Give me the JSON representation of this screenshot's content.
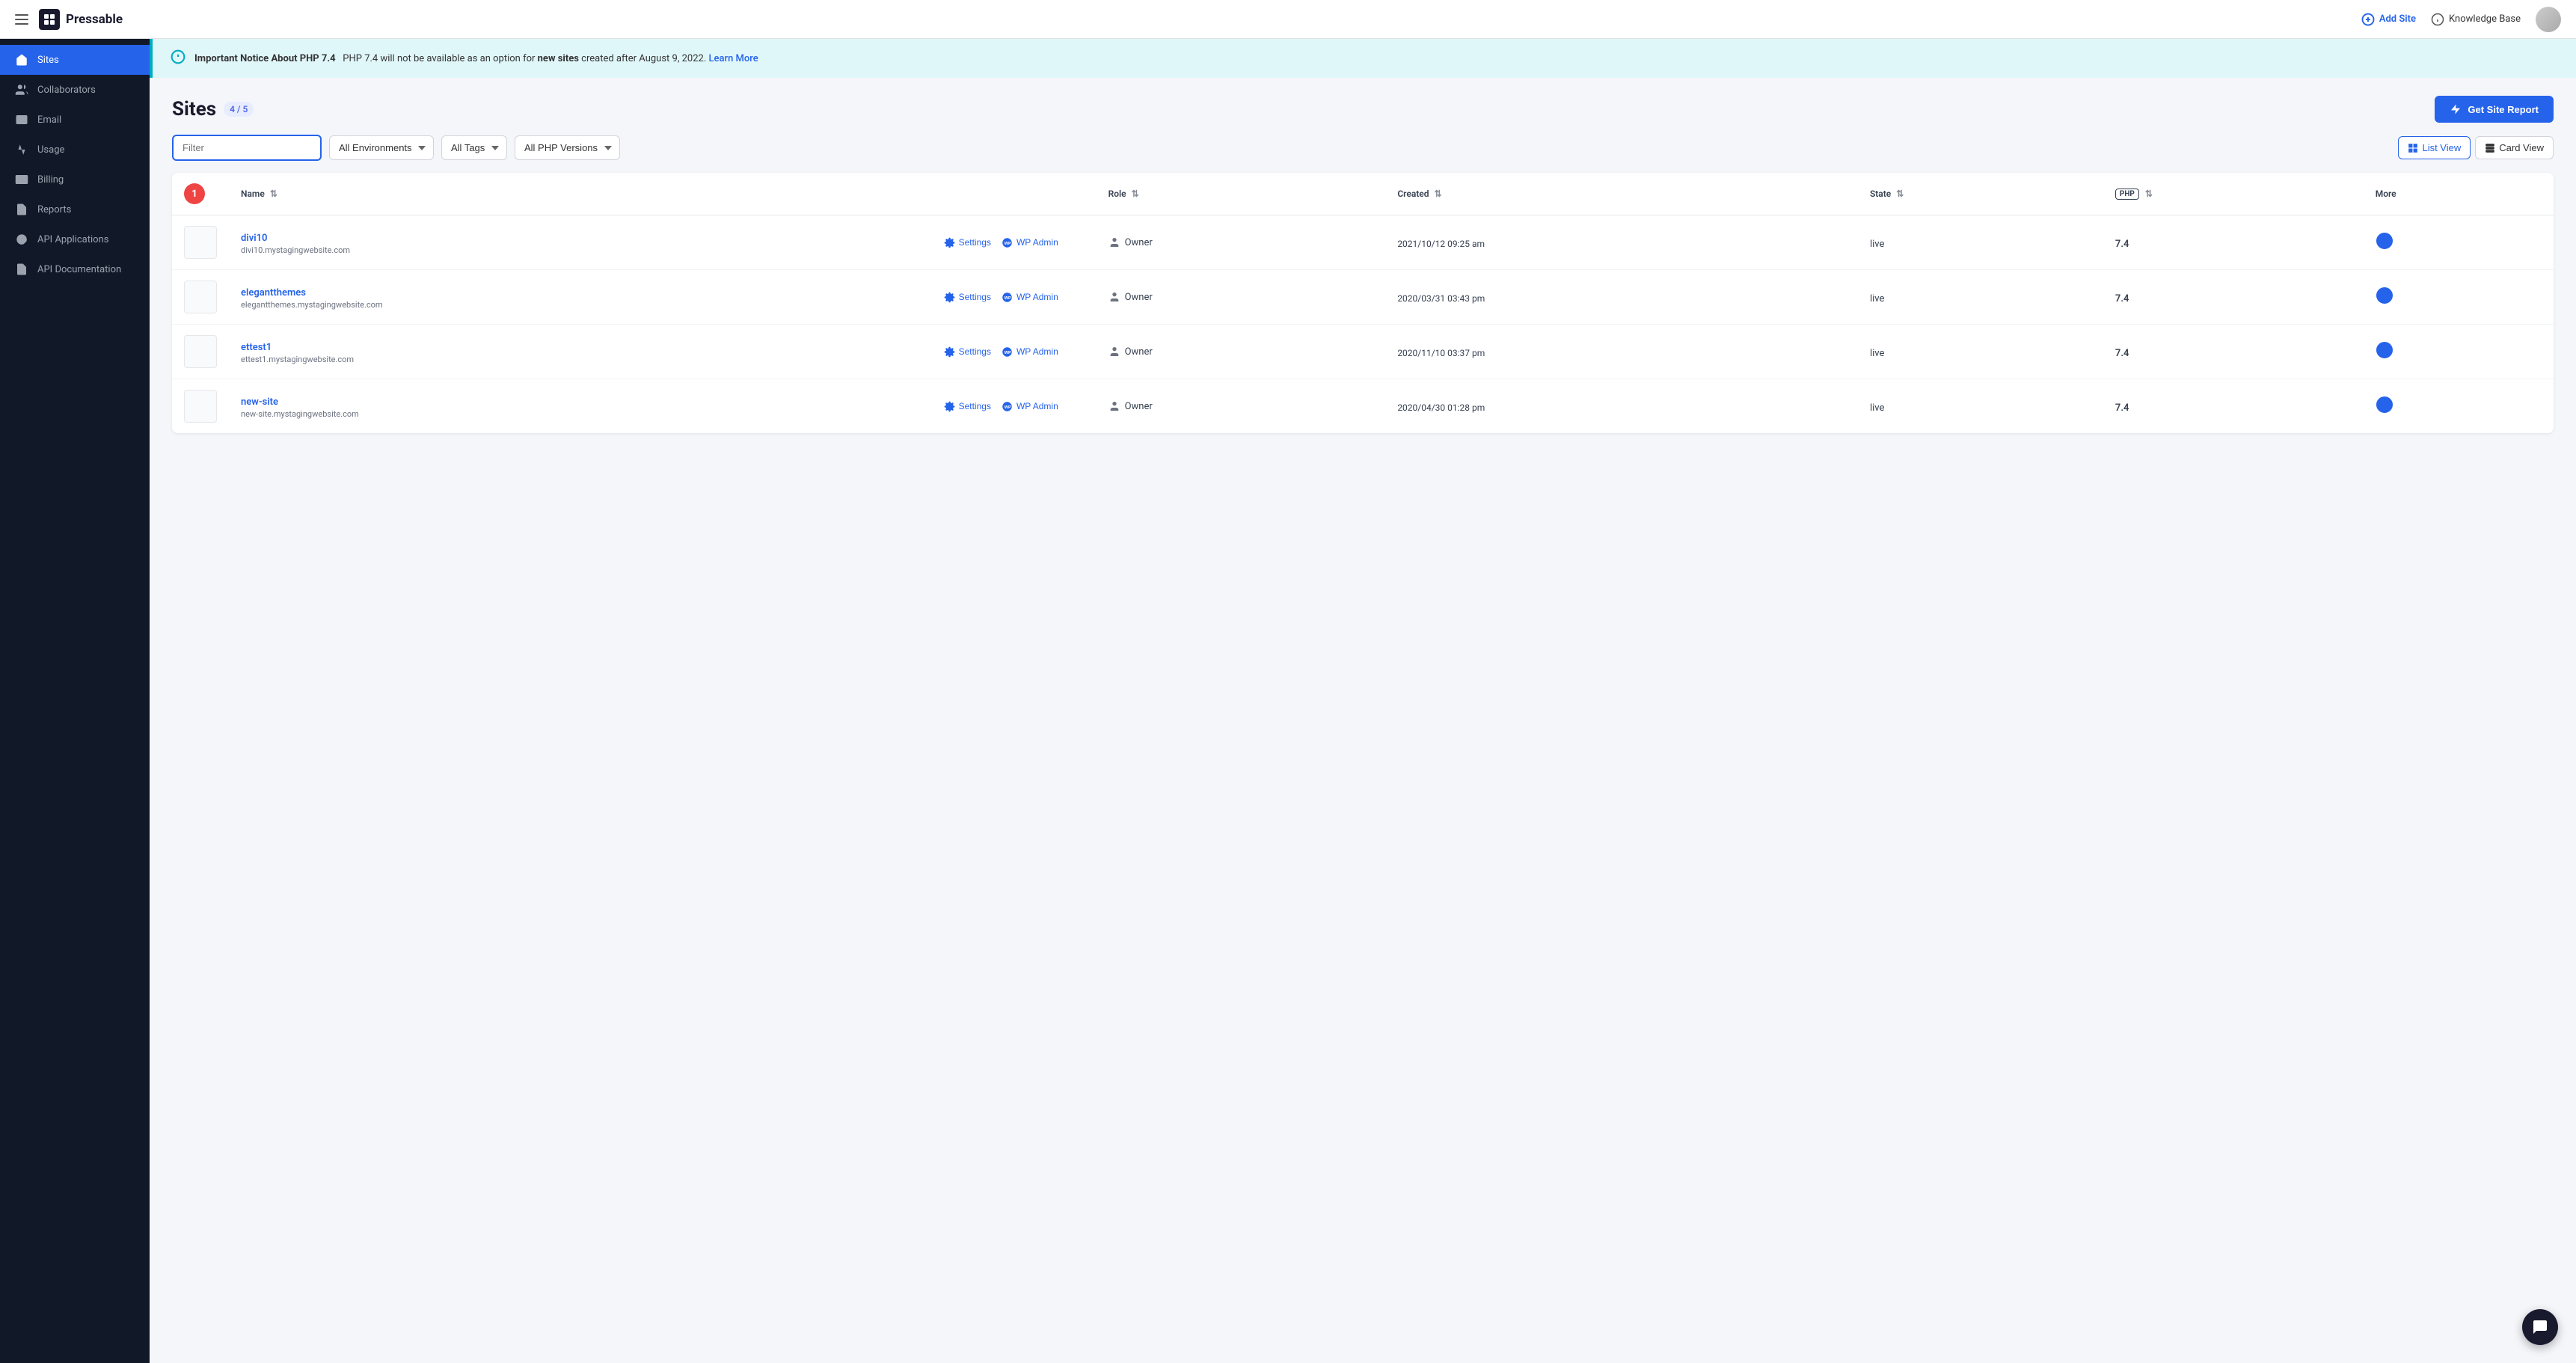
{
  "topNav": {
    "hamburger_label": "menu",
    "logo_text": "Pressable",
    "add_site_label": "Add Site",
    "knowledge_base_label": "Knowledge Base"
  },
  "sidebar": {
    "items": [
      {
        "id": "sites",
        "label": "Sites",
        "active": true
      },
      {
        "id": "collaborators",
        "label": "Collaborators",
        "active": false
      },
      {
        "id": "email",
        "label": "Email",
        "active": false
      },
      {
        "id": "usage",
        "label": "Usage",
        "active": false
      },
      {
        "id": "billing",
        "label": "Billing",
        "active": false
      },
      {
        "id": "reports",
        "label": "Reports",
        "active": false
      },
      {
        "id": "api-applications",
        "label": "API Applications",
        "active": false
      },
      {
        "id": "api-documentation",
        "label": "API Documentation",
        "active": false
      }
    ]
  },
  "notice": {
    "title": "Important Notice About PHP 7.4",
    "text": "PHP 7.4 will not be available as an option for ",
    "bold_text": "new sites",
    "text2": " created after August 9, 2022. ",
    "link_text": "Learn More"
  },
  "page": {
    "title": "Sites",
    "count": "4 / 5",
    "get_report_label": "Get Site Report"
  },
  "filters": {
    "filter_placeholder": "Filter",
    "env_label": "All Environments",
    "tags_label": "All Tags",
    "php_label": "All PHP Versions",
    "list_view_label": "List View",
    "card_view_label": "Card View"
  },
  "table": {
    "badge_count": "1",
    "columns": {
      "name": "Name",
      "role": "Role",
      "created": "Created",
      "state": "State",
      "php": "PHP",
      "more": "More"
    },
    "rows": [
      {
        "id": "divi10",
        "name": "divi10",
        "url": "divi10.mystagingwebsite.com",
        "settings_label": "Settings",
        "wp_admin_label": "WP Admin",
        "role": "Owner",
        "created": "2021/10/12 09:25 am",
        "state": "live",
        "php": "7.4"
      },
      {
        "id": "elegantthemes",
        "name": "elegantthemes",
        "url": "elegantthemes.mystagingwebsite.com",
        "settings_label": "Settings",
        "wp_admin_label": "WP Admin",
        "role": "Owner",
        "created": "2020/03/31 03:43 pm",
        "state": "live",
        "php": "7.4"
      },
      {
        "id": "ettest1",
        "name": "ettest1",
        "url": "ettest1.mystagingwebsite.com",
        "settings_label": "Settings",
        "wp_admin_label": "WP Admin",
        "role": "Owner",
        "created": "2020/11/10 03:37 pm",
        "state": "live",
        "php": "7.4"
      },
      {
        "id": "new-site",
        "name": "new-site",
        "url": "new-site.mystagingwebsite.com",
        "settings_label": "Settings",
        "wp_admin_label": "WP Admin",
        "role": "Owner",
        "created": "2020/04/30 01:28 pm",
        "state": "live",
        "php": "7.4"
      }
    ]
  }
}
